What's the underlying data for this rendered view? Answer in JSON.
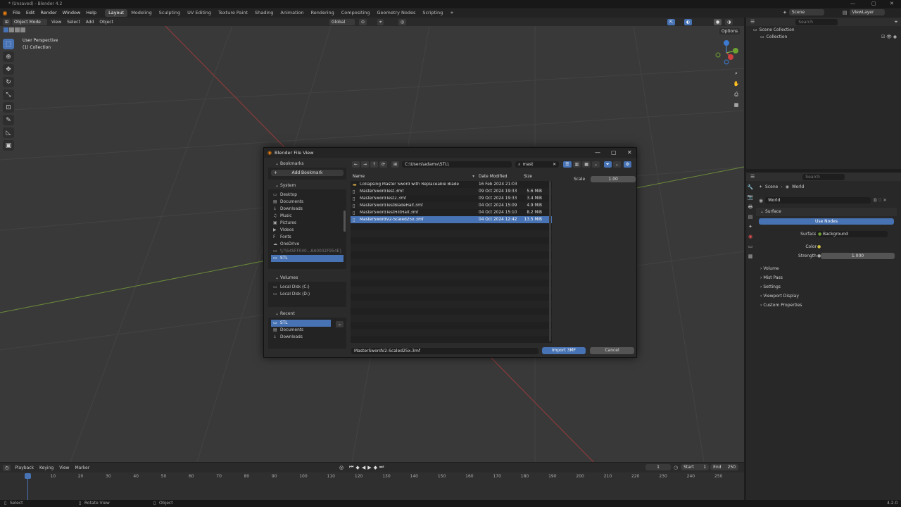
{
  "app": {
    "window_title": "* (Unsaved) - Blender 4.2",
    "version": "4.2.0"
  },
  "menu": [
    "File",
    "Edit",
    "Render",
    "Window",
    "Help"
  ],
  "workspaces": [
    "Layout",
    "Modeling",
    "Sculpting",
    "UV Editing",
    "Texture Paint",
    "Shading",
    "Animation",
    "Rendering",
    "Compositing",
    "Geometry Nodes",
    "Scripting",
    "+"
  ],
  "top_right": {
    "scene": "Scene",
    "view_layer": "ViewLayer"
  },
  "viewport_header": {
    "mode": "Object Mode",
    "menus": [
      "View",
      "Select",
      "Add",
      "Object"
    ],
    "orientation": "Global",
    "options": "Options"
  },
  "viewport": {
    "perspective": "User Perspective",
    "collection": "(1) Collection"
  },
  "outliner": {
    "search_placeholder": "Search",
    "items": [
      "Scene Collection",
      "Collection"
    ]
  },
  "properties": {
    "search_placeholder": "Search",
    "breadcrumb": [
      "Scene",
      "World"
    ],
    "world_name": "World",
    "surface_header": "Surface",
    "use_nodes": "Use Nodes",
    "surface_label": "Surface",
    "surface_value": "Background",
    "color_label": "Color",
    "strength_label": "Strength",
    "strength_value": "1.000",
    "collapsed_sections": [
      "Volume",
      "Mist Pass",
      "Settings",
      "Viewport Display",
      "Custom Properties"
    ]
  },
  "timeline": {
    "menus": [
      "Playback",
      "Keying",
      "View",
      "Marker"
    ],
    "current_frame": "1",
    "start_label": "Start",
    "start": "1",
    "end_label": "End",
    "end": "250",
    "ticks": [
      "1",
      "10",
      "20",
      "30",
      "40",
      "50",
      "60",
      "70",
      "80",
      "90",
      "100",
      "110",
      "120",
      "130",
      "140",
      "150",
      "160",
      "170",
      "180",
      "190",
      "200",
      "210",
      "220",
      "230",
      "240",
      "250"
    ]
  },
  "statusbar": {
    "select": "Select",
    "rotate": "Rotate View",
    "object": "Object"
  },
  "dialog": {
    "title": "Blender File View",
    "path": "C:\\Users\\adamv\\STL\\",
    "search": "mast",
    "scale_label": "Scale",
    "scale_value": "1.00",
    "bookmarks_header": "Bookmarks",
    "add_bookmark": "Add Bookmark",
    "system_header": "System",
    "system_items": [
      "Desktop",
      "Documents",
      "Downloads",
      "Music",
      "Pictures",
      "Videos",
      "Fonts",
      "OneDrive",
      "\\\\?\\S4SFF040...AA0002F954E}",
      "STL"
    ],
    "volumes_header": "Volumes",
    "volume_items": [
      "Local Disk (C:)",
      "Local Disk (D:)"
    ],
    "recent_header": "Recent",
    "recent_items": [
      "STL",
      "Documents",
      "Downloads"
    ],
    "columns": {
      "name": "Name",
      "date": "Date Modified",
      "size": "Size"
    },
    "files": [
      {
        "name": "Collapsing Master Sword with Replaceable Blade",
        "date": "16 Feb 2024 21:03",
        "size": "",
        "type": "folder"
      },
      {
        "name": "MasterSwordTest.3mf",
        "date": "09 Oct 2024 19:33",
        "size": "5.6 MiB",
        "type": "file"
      },
      {
        "name": "MasterSwordTest2.3mf",
        "date": "09 Oct 2024 19:33",
        "size": "3.4 MiB",
        "type": "file"
      },
      {
        "name": "MasterSwordTestBladeHalf.3mf",
        "date": "04 Oct 2024 15:09",
        "size": "4.9 MiB",
        "type": "file"
      },
      {
        "name": "MasterSwordTestHiltHalf.3mf",
        "date": "04 Oct 2024 15:10",
        "size": "8.2 MiB",
        "type": "file"
      },
      {
        "name": "MasterSwordV2-Scaled25x.3mf",
        "date": "04 Oct 2024 12:42",
        "size": "13.5 MiB",
        "type": "file"
      }
    ],
    "filename": "MasterSwordV2-Scaled25x.3mf",
    "import_button": "Import 3MF",
    "cancel_button": "Cancel"
  }
}
